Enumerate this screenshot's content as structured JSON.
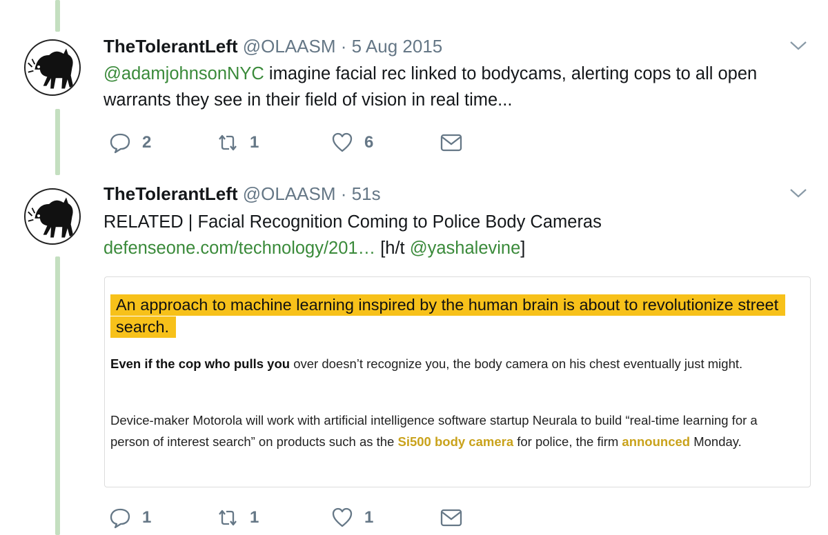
{
  "theme": {
    "link_color": "#3a8a3a",
    "thread_color": "#c4dfc0",
    "highlight_color": "#f7c11a",
    "muted": "#657786"
  },
  "tweets": [
    {
      "name": "TheTolerantLeft",
      "handle": "@OLAASM",
      "separator": "·",
      "time": "5 Aug 2015",
      "mention": "@adamjohnsonNYC",
      "text": " imagine facial rec linked to bodycams, alerting cops to all open warrants they see in their field of vision in real time...",
      "actions": {
        "replies": "2",
        "retweets": "1",
        "likes": "6"
      },
      "icons": [
        "reply-icon",
        "retweet-icon",
        "heart-icon",
        "mail-icon"
      ]
    },
    {
      "name": "TheTolerantLeft",
      "handle": "@OLAASM",
      "separator": "·",
      "time": "51s",
      "text_line1": "RELATED | Facial Recognition Coming to Police Body Cameras",
      "link": "defenseone.com/technology/201…",
      "ht_prefix": " [h/t ",
      "ht_mention": "@yashalevine",
      "ht_suffix": "]",
      "card": {
        "headline": "An approach to machine learning inspired by the human brain is about to revolutionize street search.",
        "p1_bold": "Even if the cop who pulls you",
        "p1_rest": " over doesn’t recognize you, the body camera on his chest eventually just might.",
        "p2_a": "Device-maker Motorola will work with artificial intelligence software startup Neurala to build “real-time learning for a person of interest search” on products such as the ",
        "p2_link1": "Si500 body camera",
        "p2_b": " for police, the firm ",
        "p2_link2": "announced",
        "p2_c": " Monday."
      },
      "actions": {
        "replies": "1",
        "retweets": "1",
        "likes": "1"
      },
      "icons": [
        "reply-icon",
        "retweet-icon",
        "heart-icon",
        "mail-icon"
      ]
    }
  ]
}
